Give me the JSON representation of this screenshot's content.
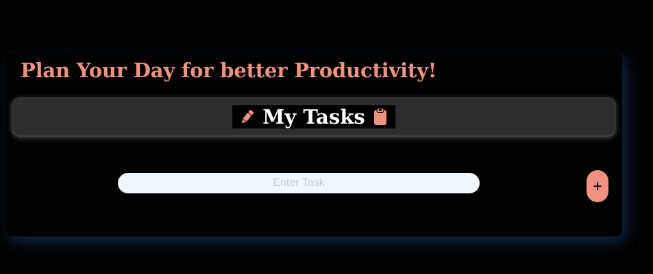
{
  "app": {
    "title": "Plan Your Day for better Productivity!",
    "header": {
      "label": "My Tasks",
      "left_icon": "pencil-icon",
      "right_icon": "clipboard-icon"
    },
    "task_input": {
      "placeholder": "Enter Task",
      "value": ""
    },
    "add_button": {
      "label": "+"
    }
  },
  "colors": {
    "accent": "#f0927f",
    "background": "#000000",
    "header_bar": "#2e2e2e",
    "input_background": "#f0f6ff",
    "card_glow": "#285aa0"
  }
}
